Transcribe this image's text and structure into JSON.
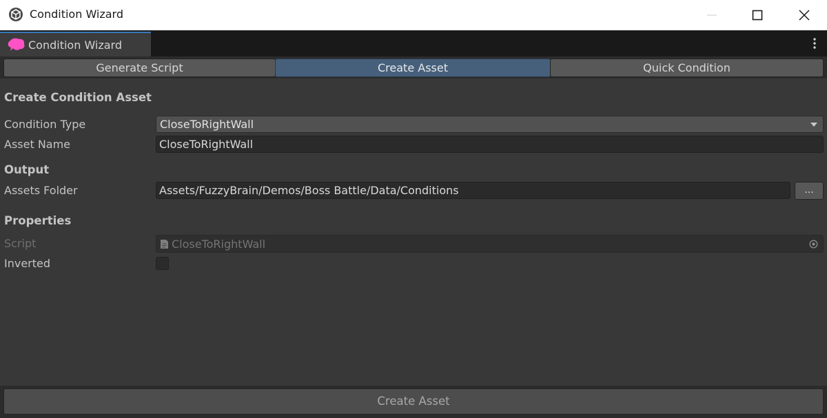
{
  "window": {
    "title": "Condition Wizard",
    "icon": "unity-logo-icon"
  },
  "editor_tab": {
    "label": "Condition Wizard",
    "icon": "brain-icon",
    "icon_color": "#ff52c6"
  },
  "toolbar": {
    "tabs": [
      {
        "label": "Generate Script",
        "active": false
      },
      {
        "label": "Create Asset",
        "active": true
      },
      {
        "label": "Quick Condition",
        "active": false
      }
    ]
  },
  "create_section": {
    "heading": "Create Condition Asset",
    "condition_type_label": "Condition Type",
    "condition_type_value": "CloseToRightWall",
    "asset_name_label": "Asset Name",
    "asset_name_value": "CloseToRightWall"
  },
  "output_section": {
    "heading": "Output",
    "assets_folder_label": "Assets Folder",
    "assets_folder_value": "Assets/FuzzyBrain/Demos/Boss Battle/Data/Conditions",
    "browse_label": "..."
  },
  "properties_section": {
    "heading": "Properties",
    "script_label": "Script",
    "script_value": "CloseToRightWall",
    "inverted_label": "Inverted",
    "inverted_checked": false
  },
  "footer": {
    "create_button_label": "Create Asset"
  },
  "colors": {
    "active_tab": "#46607c",
    "panel_bg": "#383838",
    "accent": "#3a79bb"
  }
}
